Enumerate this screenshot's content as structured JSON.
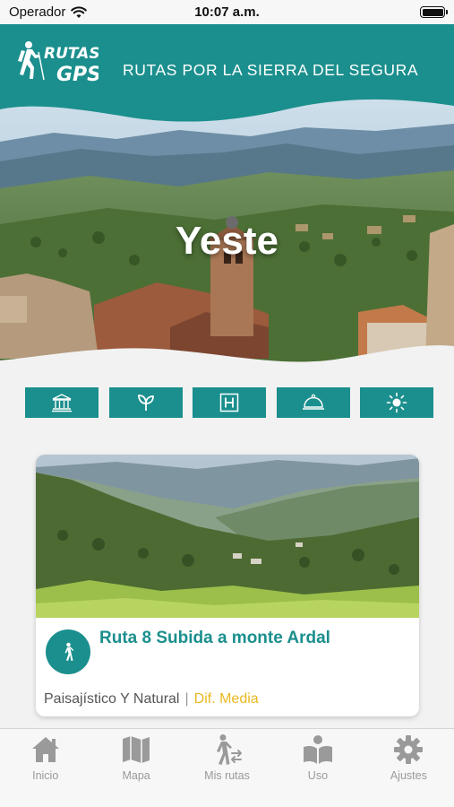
{
  "status_bar": {
    "carrier": "Operador",
    "time": "10:07 a.m."
  },
  "header": {
    "logo_text": "RUTAS GPS",
    "title": "RUTAS POR LA SIERRA DEL SEGURA"
  },
  "hero": {
    "town": "Yeste"
  },
  "categories": [
    {
      "icon": "monument-icon"
    },
    {
      "icon": "leaf-icon"
    },
    {
      "icon": "hotel-icon"
    },
    {
      "icon": "restaurant-cloche-icon"
    },
    {
      "icon": "sun-icon"
    }
  ],
  "route_card": {
    "title": "Ruta 8 Subida a monte Ardal",
    "category": "Paisajístico Y Natural",
    "separator": "|",
    "difficulty": "Dif. Media",
    "icon": "hiker-icon"
  },
  "tabs": [
    {
      "label": "Inicio",
      "icon": "home-icon"
    },
    {
      "label": "Mapa",
      "icon": "map-icon"
    },
    {
      "label": "Mis rutas",
      "icon": "my-routes-icon"
    },
    {
      "label": "Uso",
      "icon": "book-icon"
    },
    {
      "label": "Ajustes",
      "icon": "gear-icon"
    }
  ],
  "colors": {
    "primary": "#1b8f8d",
    "difficulty": "#e9b820",
    "tab_inactive": "#9a9a9a"
  }
}
